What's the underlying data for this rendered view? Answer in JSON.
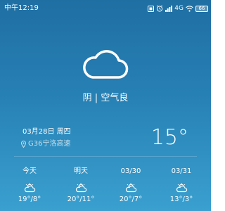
{
  "status_bar": {
    "time": "中午12:19",
    "network": "4G",
    "battery": "66"
  },
  "weather": {
    "icon": "cloud-icon",
    "condition": "阴",
    "separator": "|",
    "air_quality": "空气良",
    "date": "03月28日",
    "weekday": "周四",
    "location": "G36宁洛高速",
    "temperature": "15°"
  },
  "forecast": [
    {
      "label": "今天",
      "icon": "cloudy-sun-icon",
      "temps": "19°/8°"
    },
    {
      "label": "明天",
      "icon": "cloudy-sun-icon",
      "temps": "20°/11°"
    },
    {
      "label": "03/30",
      "icon": "cloudy-sun-icon",
      "temps": "20°/7°"
    },
    {
      "label": "03/31",
      "icon": "cloudy-sun-icon",
      "temps": "13°/3°"
    }
  ],
  "colors": {
    "background_top": "#1f6fa3",
    "background_bottom": "#3aa0cf",
    "text": "#ffffff"
  }
}
